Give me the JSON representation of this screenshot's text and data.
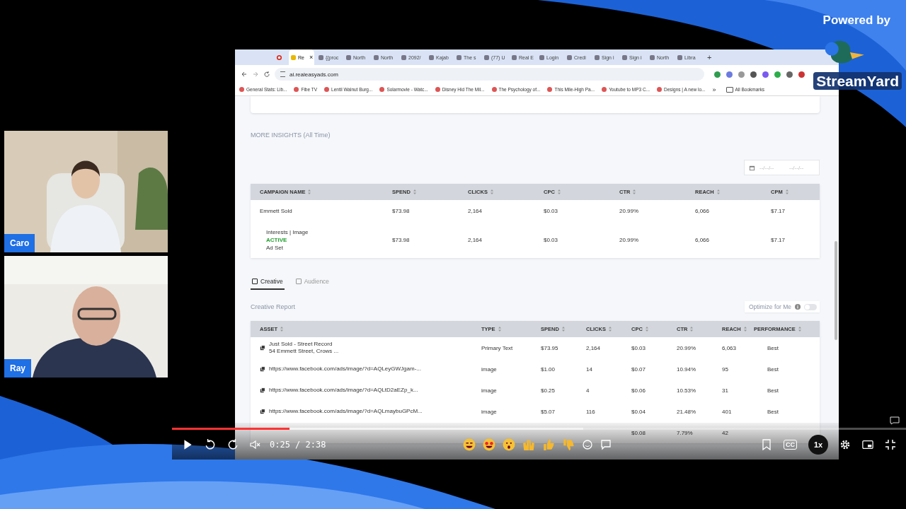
{
  "branding": {
    "caption": "Powered by",
    "logo": "StreamYard"
  },
  "participants": [
    {
      "name": "Caro"
    },
    {
      "name": "Ray"
    }
  ],
  "browser": {
    "tabs": [
      {
        "label": "Re",
        "selected": true
      },
      {
        "label": "{{proc",
        "selected": false
      },
      {
        "label": "North",
        "selected": false
      },
      {
        "label": "North",
        "selected": false
      },
      {
        "label": "2092/",
        "selected": false
      },
      {
        "label": "Kajab",
        "selected": false
      },
      {
        "label": "The s",
        "selected": false
      },
      {
        "label": "(77) U",
        "selected": false
      },
      {
        "label": "Real E",
        "selected": false
      },
      {
        "label": "Login",
        "selected": false
      },
      {
        "label": "Credi",
        "selected": false
      },
      {
        "label": "Sign i",
        "selected": false
      },
      {
        "label": "Sign i",
        "selected": false
      },
      {
        "label": "North",
        "selected": false
      },
      {
        "label": "Libra",
        "selected": false
      }
    ],
    "new_tab": "+",
    "close_tab": "×",
    "address": "ai.realeasyads.com",
    "bookmarks": [
      "General Stats: Lib...",
      "Fibe TV",
      "Lentil Walnut Burg...",
      "Solarmovie - Watc...",
      "Disney Hid The Mil...",
      "The Psychology of...",
      "This Mile-High Pa...",
      "Youtube to MP3 C...",
      "Designs | A new lo..."
    ],
    "more_bookmarks": "»",
    "all_bookmarks": "All Bookmarks"
  },
  "page": {
    "section_title": "MORE INSIGHTS (All Time)",
    "date_range": {
      "start_placeholder": "--/--/--",
      "end_placeholder": "--/--/--"
    },
    "campaign_table": {
      "columns": [
        "CAMPAIGN NAME",
        "SPEND",
        "CLICKS",
        "CPC",
        "CTR",
        "REACH",
        "CPM"
      ],
      "rows": [
        {
          "cells": [
            "Emmett Sold",
            "$73.98",
            "2,164",
            "$0.03",
            "20.99%",
            "6,066",
            "$7.17"
          ]
        },
        {
          "status": "ACTIVE",
          "level_label": "Ad Set",
          "cells": [
            "Interests | Image",
            "$73.98",
            "2,164",
            "$0.03",
            "20.99%",
            "6,066",
            "$7.17"
          ]
        }
      ]
    },
    "tabs": [
      {
        "label": "Creative",
        "selected": true
      },
      {
        "label": "Audience",
        "selected": false
      }
    ],
    "report_title": "Creative Report",
    "optimize": {
      "label": "Optimize for Me",
      "on": false
    },
    "creative_table": {
      "columns": [
        "ASSET",
        "TYPE",
        "SPEND",
        "CLICKS",
        "CPC",
        "CTR",
        "REACH",
        "PERFORMANCE"
      ],
      "rows": [
        {
          "asset_detail": "54 Emmett Street, Crows ...",
          "cells": [
            "Just Sold - Street Record",
            "Primary Text",
            "$73.95",
            "2,164",
            "$0.03",
            "20.99%",
            "6,063",
            "Best"
          ]
        },
        {
          "cells": [
            "https://www.facebook.com/ads/image/?d=AQLeyGWJgam-...",
            "image",
            "$1.00",
            "14",
            "$0.07",
            "10.94%",
            "95",
            "Best"
          ]
        },
        {
          "cells": [
            "https://www.facebook.com/ads/image/?d=AQLtD2aEZp_k...",
            "image",
            "$0.25",
            "4",
            "$0.06",
            "10.53%",
            "31",
            "Best"
          ]
        },
        {
          "cells": [
            "https://www.facebook.com/ads/image/?d=AQLmaybuGPcM...",
            "image",
            "$5.07",
            "116",
            "$0.04",
            "21.48%",
            "401",
            "Best"
          ]
        },
        {
          "cells": [
            null,
            null,
            null,
            null,
            "$0.08",
            "7.79%",
            "42",
            null
          ]
        }
      ]
    }
  },
  "player": {
    "level": 0.16,
    "time": "0:25 / 2:38",
    "captions": "CC",
    "speed": "1x",
    "playing": false,
    "muted": true
  }
}
